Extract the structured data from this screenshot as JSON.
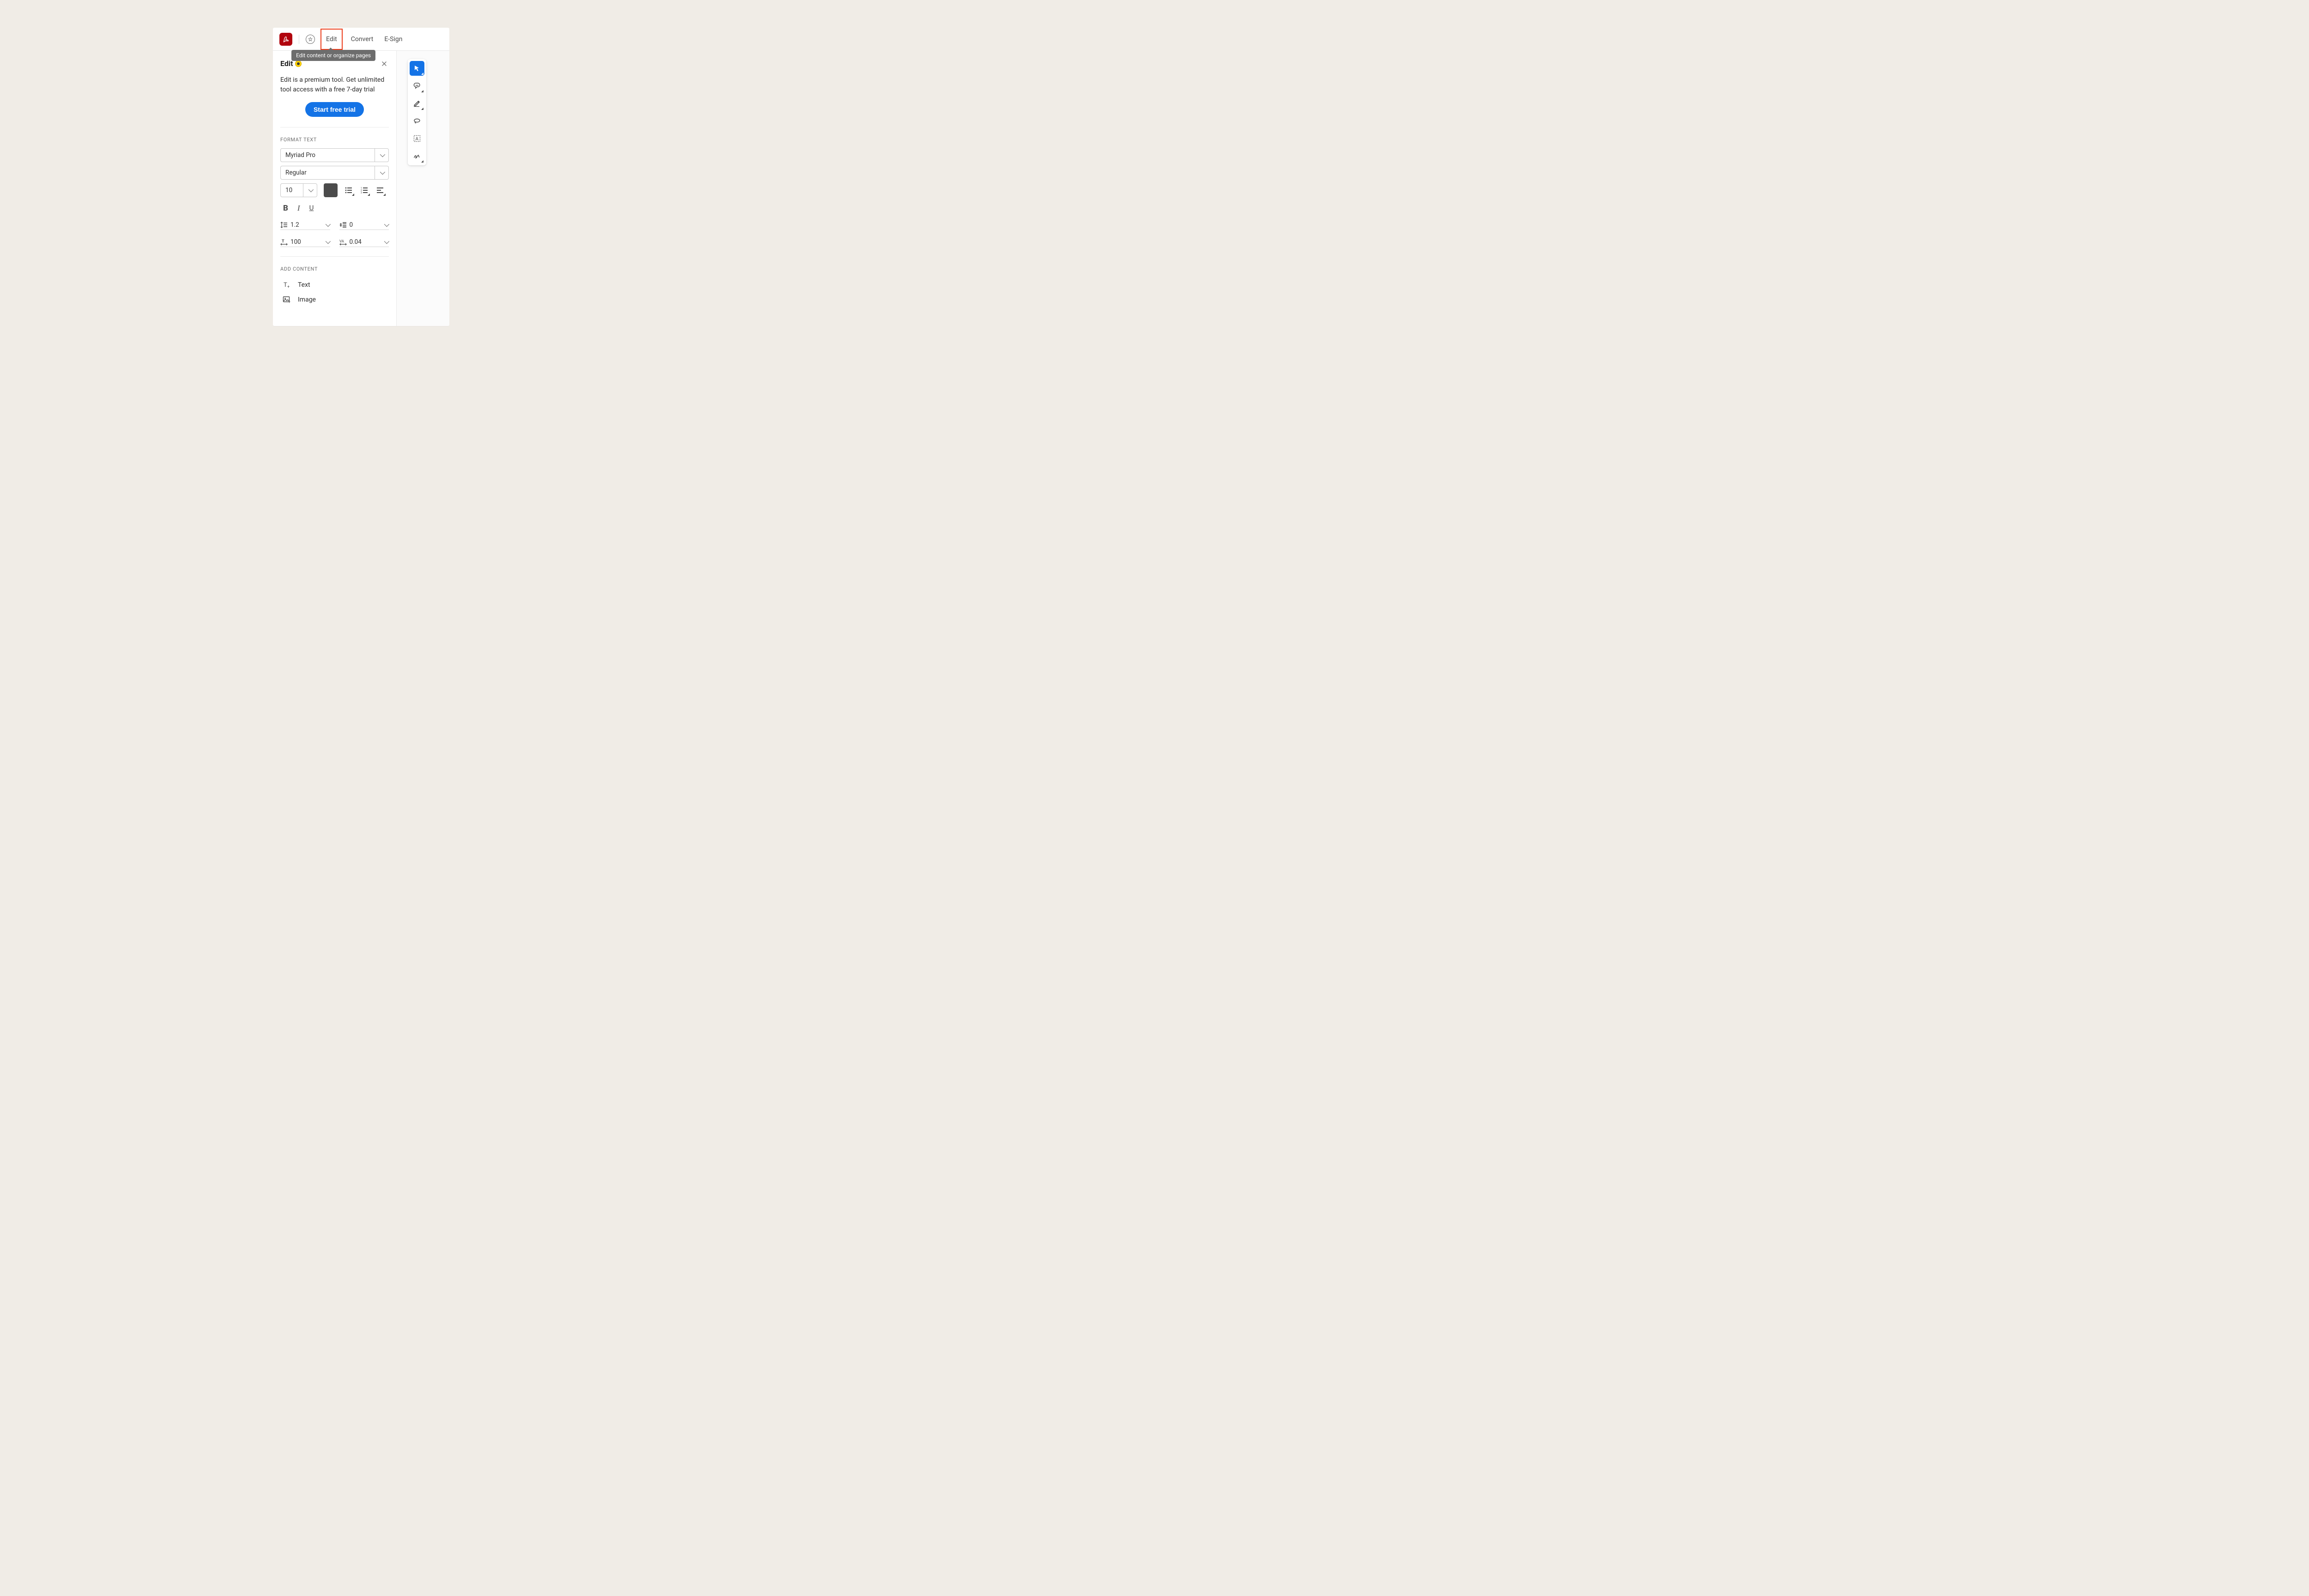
{
  "topbar": {
    "tabs": [
      "Edit",
      "Convert",
      "E-Sign"
    ],
    "activeTab": "Edit",
    "tooltip": "Edit content or organize pages"
  },
  "panel": {
    "title": "Edit",
    "promo": "Edit is a premium tool. Get unlimited tool access with a free 7-day trial",
    "cta": "Start free trial"
  },
  "format": {
    "section": "FORMAT TEXT",
    "font": "Myriad Pro",
    "weight": "Regular",
    "size": "10",
    "color": "#4b4b4b",
    "lineHeight": "1.2",
    "paraSpacing": "0",
    "hscale": "100",
    "tracking": "0.04"
  },
  "add": {
    "section": "ADD CONTENT",
    "text": "Text",
    "image": "Image"
  },
  "rail": {
    "items": [
      "select",
      "comment",
      "highlight",
      "lasso",
      "textselect",
      "sign"
    ]
  }
}
